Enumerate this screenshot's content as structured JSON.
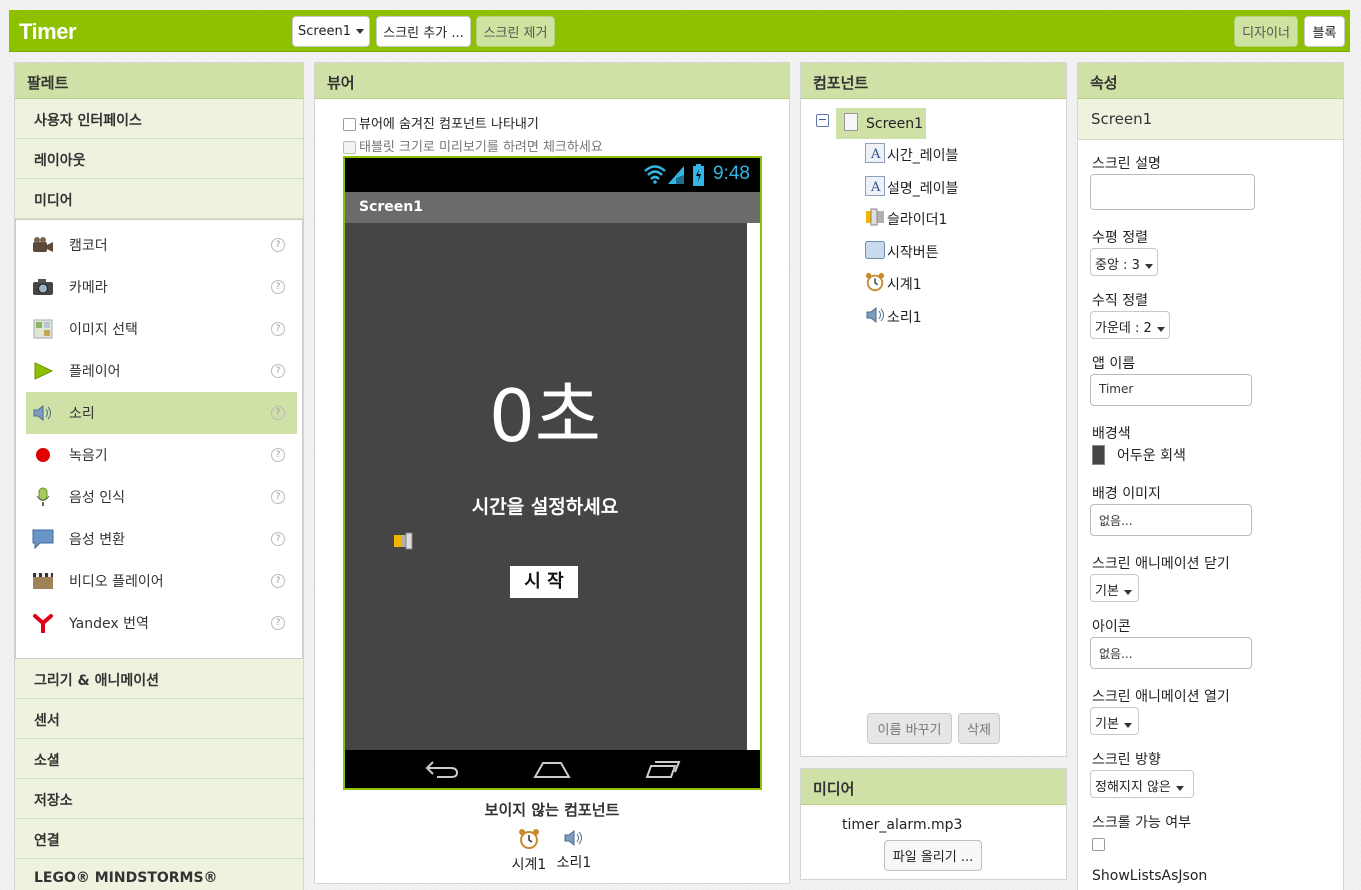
{
  "app": {
    "title": "Timer"
  },
  "toolbar": {
    "screen_select": "Screen1",
    "add_screen": "스크린 추가 ...",
    "remove_screen": "스크린 제거",
    "designer": "디자이너",
    "blocks": "블록"
  },
  "palette": {
    "header": "팔레트",
    "categories_top": [
      "사용자 인터페이스",
      "레이아웃",
      "미디어"
    ],
    "media_items": [
      {
        "label": "캠코더",
        "icon": "camcorder-icon"
      },
      {
        "label": "카메라",
        "icon": "camera-icon"
      },
      {
        "label": "이미지 선택",
        "icon": "image-picker-icon"
      },
      {
        "label": "플레이어",
        "icon": "player-icon"
      },
      {
        "label": "소리",
        "icon": "sound-icon"
      },
      {
        "label": "녹음기",
        "icon": "recorder-icon"
      },
      {
        "label": "음성 인식",
        "icon": "speech-recognizer-icon"
      },
      {
        "label": "음성 변환",
        "icon": "text-to-speech-icon"
      },
      {
        "label": "비디오 플레이어",
        "icon": "video-player-icon"
      },
      {
        "label": "Yandex 번역",
        "icon": "yandex-icon"
      }
    ],
    "help_glyph": "?",
    "categories_bottom": [
      "그리기 & 애니메이션",
      "센서",
      "소셜",
      "저장소",
      "연결",
      "LEGO® MINDSTORMS®"
    ]
  },
  "viewer": {
    "header": "뷰어",
    "show_hidden": "뷰어에 숨겨진 컴포넌트 나타내기",
    "tablet_preview": "태블릿 크기로 미리보기를 하려면 체크하세요",
    "phone": {
      "time": "9:48",
      "screen_title": "Screen1",
      "big_text": "0초",
      "sub_text": "시간을 설정하세요",
      "button": "시 작"
    },
    "nonvisible_title": "보이지 않는 컴포넌트",
    "nonvisible": [
      {
        "label": "시계1",
        "icon": "clock-icon"
      },
      {
        "label": "소리1",
        "icon": "sound-icon"
      }
    ]
  },
  "components": {
    "header": "컴포넌트",
    "root": "Screen1",
    "collapse_glyph": "⊟",
    "children": [
      {
        "label": "시간_레이블",
        "icon": "label-icon"
      },
      {
        "label": "설명_레이블",
        "icon": "label-icon"
      },
      {
        "label": "슬라이더1",
        "icon": "slider-icon"
      },
      {
        "label": "시작버튼",
        "icon": "button-icon"
      },
      {
        "label": "시계1",
        "icon": "clock-icon"
      },
      {
        "label": "소리1",
        "icon": "sound-icon"
      }
    ],
    "rename": "이름 바꾸기",
    "delete": "삭제"
  },
  "media": {
    "header": "미디어",
    "file": "timer_alarm.mp3",
    "upload": "파일 올리기 ..."
  },
  "properties": {
    "header": "속성",
    "component": "Screen1",
    "screen_desc_label": "스크린 설명",
    "align_h_label": "수평 정렬",
    "align_h_value": "중앙 : 3",
    "align_v_label": "수직 정렬",
    "align_v_value": "가운데 : 2",
    "app_name_label": "앱 이름",
    "app_name_value": "Timer",
    "bg_color_label": "배경색",
    "bg_color_value": "어두운 회색",
    "bg_color_hex": "#444444",
    "bg_image_label": "배경 이미지",
    "bg_image_value": "없음...",
    "close_anim_label": "스크린 애니메이션 닫기",
    "close_anim_value": "기본",
    "icon_label": "아이콘",
    "icon_value": "없음...",
    "open_anim_label": "스크린 애니메이션 열기",
    "open_anim_value": "기본",
    "orientation_label": "스크린 방향",
    "orientation_value": "정해지지 않은",
    "scrollable_label": "스크롤 가능 여부",
    "show_lists_label": "ShowListsAsJson"
  },
  "colors": {
    "accent": "#8dc100",
    "panel_head": "#cfe1a6",
    "phone_bg": "#454545"
  }
}
